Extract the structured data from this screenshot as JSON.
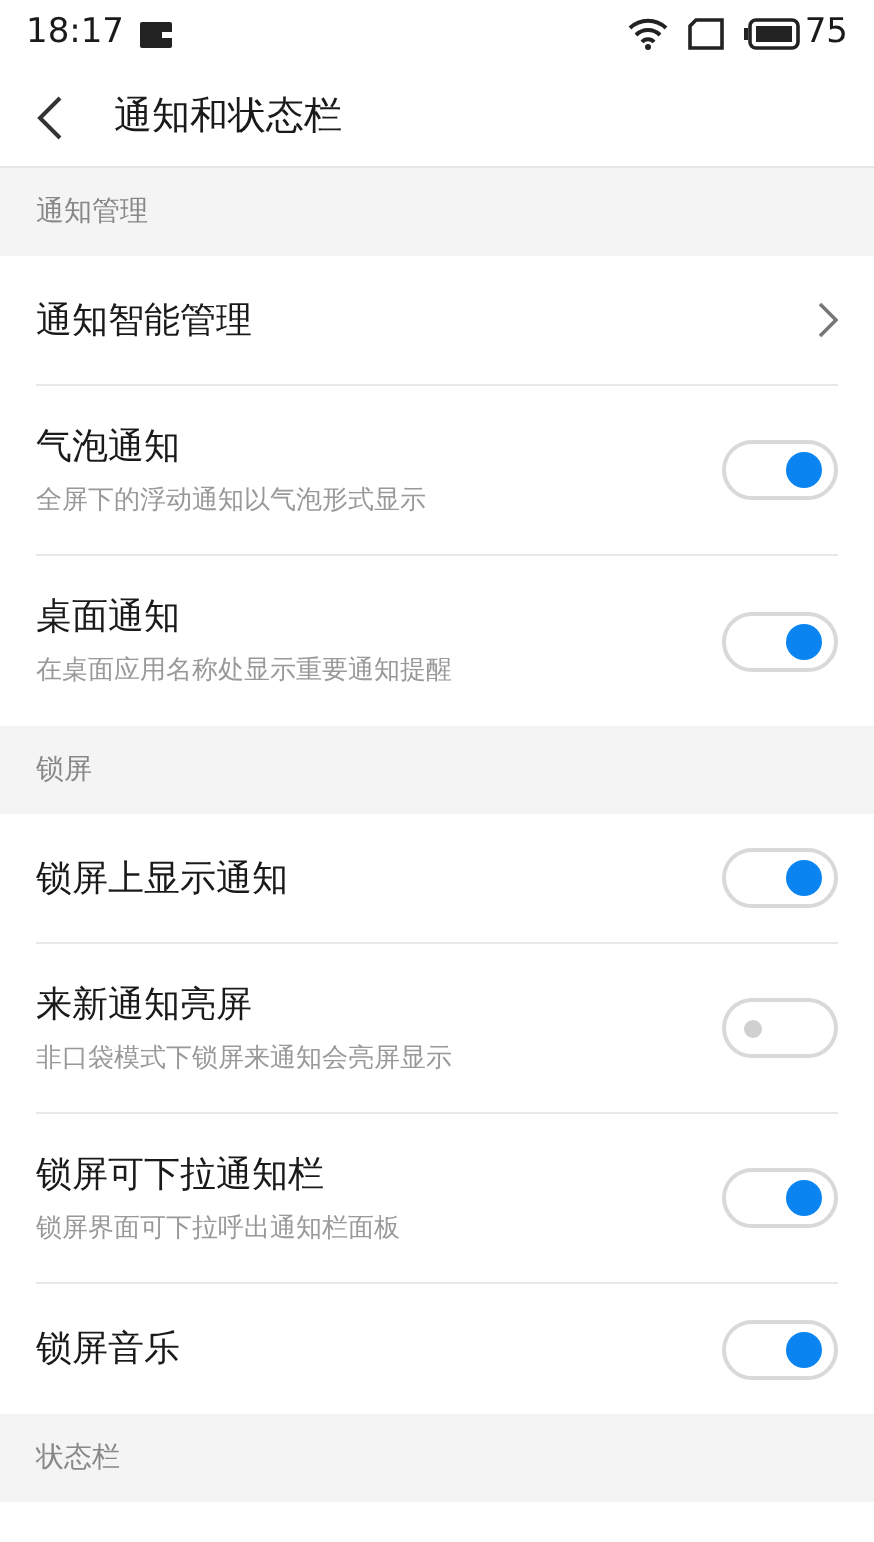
{
  "status_bar": {
    "time": "18:17",
    "battery": "75"
  },
  "header": {
    "title": "通知和状态栏"
  },
  "sections": [
    {
      "title": "通知管理",
      "items": [
        {
          "kind": "link",
          "title": "通知智能管理"
        },
        {
          "kind": "toggle",
          "title": "气泡通知",
          "subtitle": "全屏下的浮动通知以气泡形式显示",
          "on": true
        },
        {
          "kind": "toggle",
          "title": "桌面通知",
          "subtitle": "在桌面应用名称处显示重要通知提醒",
          "on": true
        }
      ]
    },
    {
      "title": "锁屏",
      "items": [
        {
          "kind": "toggle",
          "title": "锁屏上显示通知",
          "on": true
        },
        {
          "kind": "toggle",
          "title": "来新通知亮屏",
          "subtitle": "非口袋模式下锁屏来通知会亮屏显示",
          "on": false
        },
        {
          "kind": "toggle",
          "title": "锁屏可下拉通知栏",
          "subtitle": "锁屏界面可下拉呼出通知栏面板",
          "on": true
        },
        {
          "kind": "toggle",
          "title": "锁屏音乐",
          "on": true
        }
      ]
    },
    {
      "title": "状态栏"
    }
  ]
}
